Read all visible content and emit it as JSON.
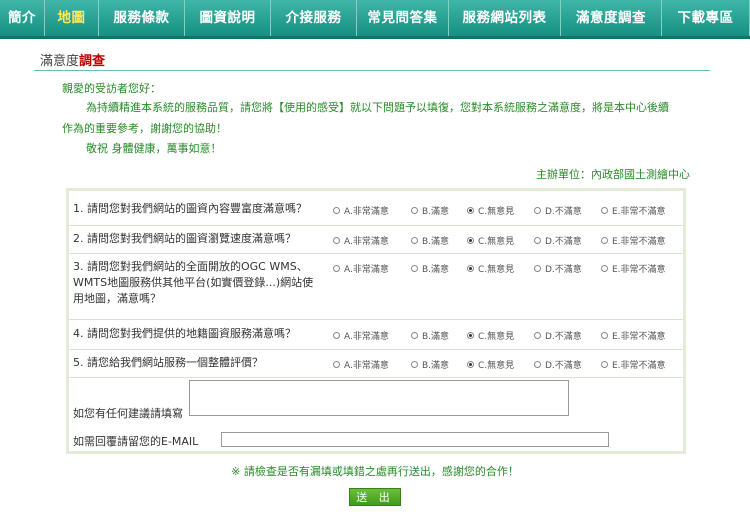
{
  "nav": {
    "items": [
      "簡介",
      "地圖",
      "服務條款",
      "圖資說明",
      "介接服務",
      "常見問答集",
      "服務網站列表",
      "滿意度調查",
      "下載專區"
    ],
    "active_index": 1
  },
  "page": {
    "title_prefix": "滿意度",
    "title_highlight": "調查"
  },
  "intro": {
    "greeting": "親愛的受訪者您好：",
    "line1": "為持續精進本系統的服務品質，請您將【使用的感受】就以下問題予以填復，您對本系統服務之滿意度，將是本中心後續",
    "line2": "作為的重要參考，謝謝您的協助！",
    "line3": "敬祝  身體健康，萬事如意！"
  },
  "sponsor": "主辦單位：內政部國土測繪中心",
  "options": [
    "A.非常滿意",
    "B.滿意",
    "C.無意見",
    "D.不滿意",
    "E.非常不滿意"
  ],
  "questions": [
    {
      "text": "1. 請問您對我們網站的圖資內容豐富度滿意嗎？",
      "selected": 2
    },
    {
      "text": "2. 請問您對我們網站的圖資瀏覽速度滿意嗎？",
      "selected": 2
    },
    {
      "text": "3. 請問您對我們網站的全面開放的OGC WMS、WMTS地圖服務供其他平台(如實價登錄...)網站使用地圖，滿意嗎？",
      "selected": 2
    },
    {
      "text": "4. 請問您對我們提供的地籍圖資服務滿意嗎？",
      "selected": 2
    },
    {
      "text": "5. 請您給我們網站服務一個整體評價？",
      "selected": 2
    }
  ],
  "suggestion_label": "如您有任何建議請填寫",
  "email_label": "如需回覆請留您的E-MAIL",
  "notice": "※ 請檢查是否有漏填或填錯之處再行送出，感謝您的合作！",
  "submit_label": "送 出"
}
